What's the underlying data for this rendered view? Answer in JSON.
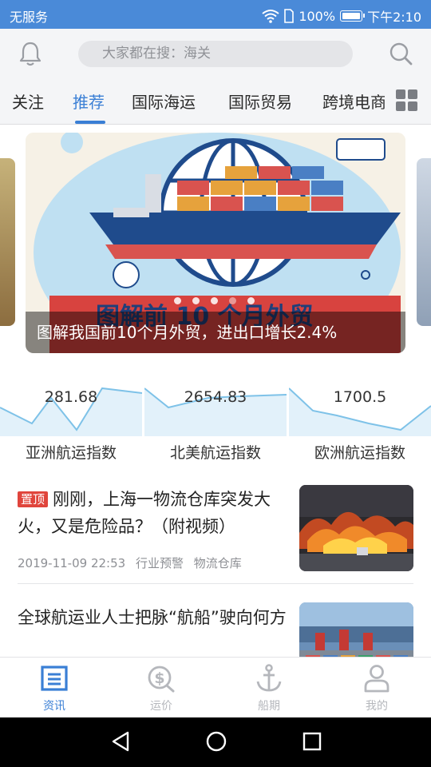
{
  "status_bar": {
    "carrier": "无服务",
    "battery": "100%",
    "time": "下午2:10"
  },
  "search": {
    "placeholder": "大家都在搜：海关"
  },
  "tabs": [
    {
      "label": "关注",
      "active": false
    },
    {
      "label": "推荐",
      "active": true
    },
    {
      "label": "国际海运",
      "active": false
    },
    {
      "label": "国际贸易",
      "active": false
    },
    {
      "label": "跨境电商",
      "active": false
    }
  ],
  "banner": {
    "caption": "图解我国前10个月外贸，进出口增长2.4%",
    "image_text": "图解前 10 个月外贸",
    "page_count": 5,
    "current_page": 4
  },
  "indices": [
    {
      "value": "281.68",
      "label": "亚洲航运指数"
    },
    {
      "value": "2654.83",
      "label": "北美航运指数"
    },
    {
      "value": "1700.5",
      "label": "欧洲航运指数"
    }
  ],
  "news": [
    {
      "badge": "置顶",
      "title": "刚刚，上海一物流仓库突发大火，又是危险品？（附视频）",
      "datetime": "2019-11-09 22:53",
      "tags": [
        "行业预警",
        "物流仓库"
      ],
      "thumb": "fire-image"
    },
    {
      "badge": "",
      "title": "全球航运业人士把脉“航船”驶向何方",
      "thumb": "port-image"
    }
  ],
  "bottom_nav": [
    {
      "label": "资讯",
      "icon": "news-icon",
      "active": true
    },
    {
      "label": "运价",
      "icon": "price-icon",
      "active": false
    },
    {
      "label": "船期",
      "icon": "anchor-icon",
      "active": false
    },
    {
      "label": "我的",
      "icon": "user-icon",
      "active": false
    }
  ],
  "colors": {
    "accent": "#3a7fd5",
    "status_bar": "#4a8ad8",
    "badge": "#e0453c",
    "index_line": "#7ec2e8"
  }
}
